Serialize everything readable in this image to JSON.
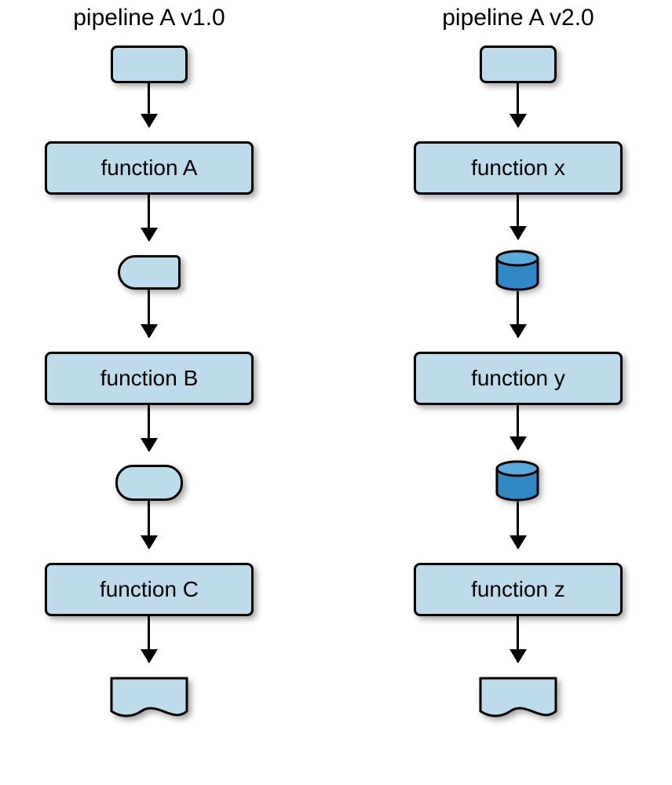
{
  "pipelines": {
    "left": {
      "title": "pipeline A v1.0",
      "funcA": "function A",
      "funcB": "function B",
      "funcC": "function C"
    },
    "right": {
      "title": "pipeline A v2.0",
      "funcX": "function x",
      "funcY": "function y",
      "funcZ": "function z"
    }
  }
}
